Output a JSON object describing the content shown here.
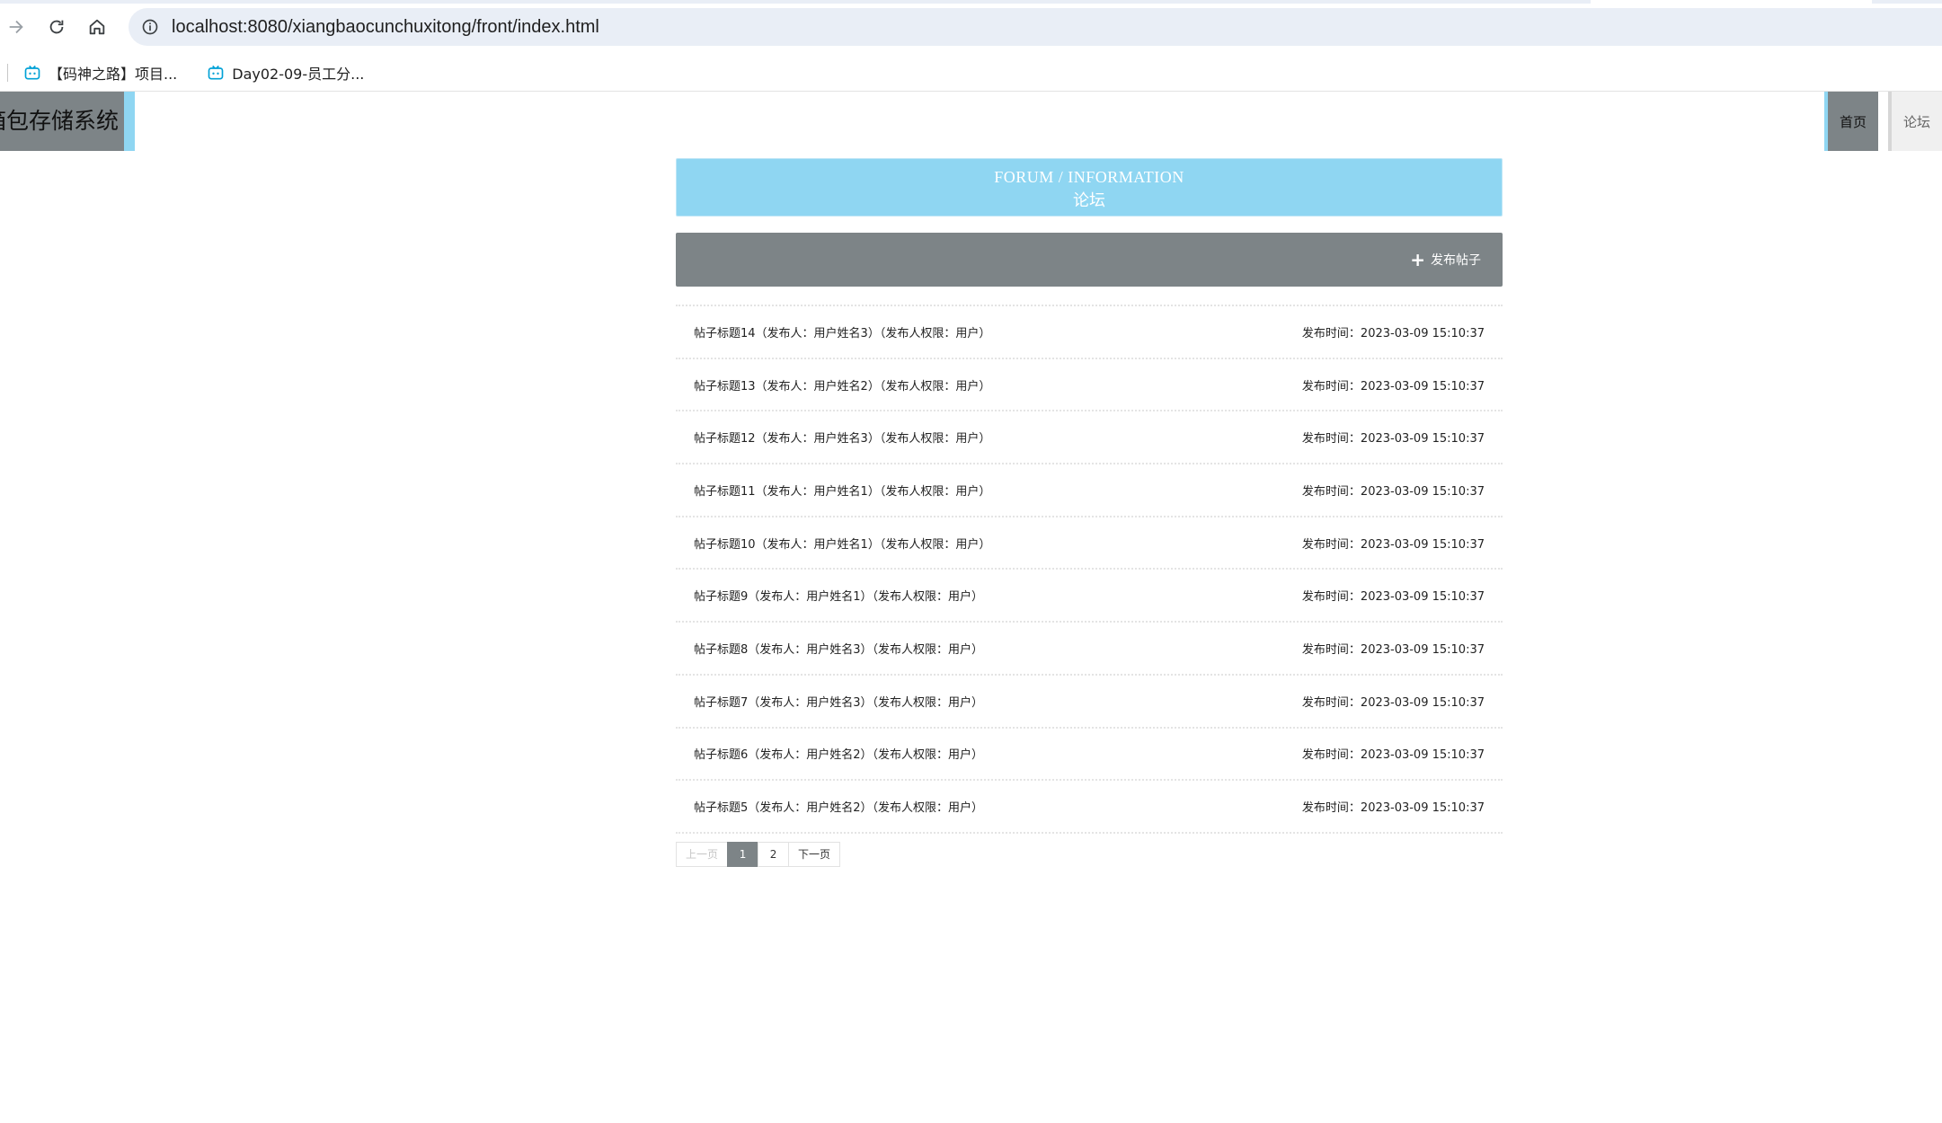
{
  "browser": {
    "url": "localhost:8080/xiangbaocunchuxitong/front/index.html",
    "bookmarks": [
      {
        "label": "【码神之路】项目..."
      },
      {
        "label": "Day02-09-员工分..."
      }
    ]
  },
  "header": {
    "logo_text": "箱包存储系统",
    "nav": {
      "home": "首页",
      "forum": "论坛"
    }
  },
  "banner": {
    "title_en": "FORUM / INFORMATION",
    "title_cn": "论坛"
  },
  "actions": {
    "post_button": "发布帖子"
  },
  "posts": [
    {
      "title": "帖子标题14（发布人：用户姓名3）（发布人权限：用户）",
      "time": "发布时间：2023-03-09 15:10:37"
    },
    {
      "title": "帖子标题13（发布人：用户姓名2）（发布人权限：用户）",
      "time": "发布时间：2023-03-09 15:10:37"
    },
    {
      "title": "帖子标题12（发布人：用户姓名3）（发布人权限：用户）",
      "time": "发布时间：2023-03-09 15:10:37"
    },
    {
      "title": "帖子标题11（发布人：用户姓名1）（发布人权限：用户）",
      "time": "发布时间：2023-03-09 15:10:37"
    },
    {
      "title": "帖子标题10（发布人：用户姓名1）（发布人权限：用户）",
      "time": "发布时间：2023-03-09 15:10:37"
    },
    {
      "title": "帖子标题9（发布人：用户姓名1）（发布人权限：用户）",
      "time": "发布时间：2023-03-09 15:10:37"
    },
    {
      "title": "帖子标题8（发布人：用户姓名3）（发布人权限：用户）",
      "time": "发布时间：2023-03-09 15:10:37"
    },
    {
      "title": "帖子标题7（发布人：用户姓名3）（发布人权限：用户）",
      "time": "发布时间：2023-03-09 15:10:37"
    },
    {
      "title": "帖子标题6（发布人：用户姓名2）（发布人权限：用户）",
      "time": "发布时间：2023-03-09 15:10:37"
    },
    {
      "title": "帖子标题5（发布人：用户姓名2）（发布人权限：用户）",
      "time": "发布时间：2023-03-09 15:10:37"
    }
  ],
  "pagination": {
    "prev": "上一页",
    "pages": [
      "1",
      "2"
    ],
    "current": "1",
    "next": "下一页"
  },
  "colors": {
    "accent": "#8fd6f2",
    "header_gray": "#7d8487"
  }
}
